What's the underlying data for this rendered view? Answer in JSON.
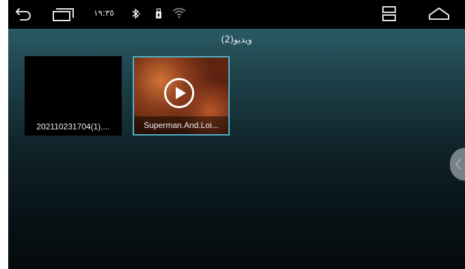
{
  "status_bar": {
    "time": "١٩:٣٥",
    "icons": [
      "back-arrow-icon",
      "recent-apps-icon",
      "bluetooth-icon",
      "usb-icon",
      "wifi-icon",
      "split-screen-icon",
      "home-icon"
    ]
  },
  "header": {
    "title": "ويديو(2)"
  },
  "videos": [
    {
      "name": "202110231704(1)....",
      "has_thumbnail": false,
      "selected": false
    },
    {
      "name": "Superman.And.Loi...",
      "has_thumbnail": true,
      "selected": true
    }
  ],
  "colors": {
    "selection_border": "#4fb3c9",
    "status_bar_bg": "#000000",
    "content_top": "#2b5a64"
  }
}
